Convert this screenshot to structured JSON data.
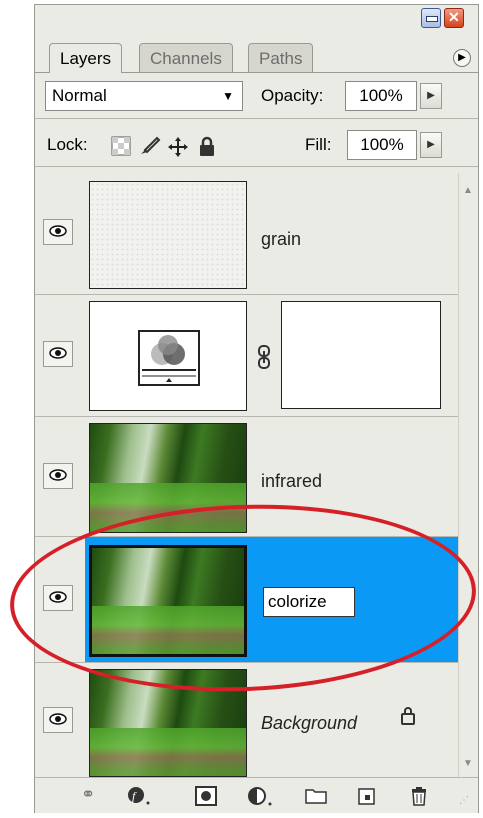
{
  "tabs": [
    {
      "label": "Layers",
      "active": true
    },
    {
      "label": "Channels",
      "active": false
    },
    {
      "label": "Paths",
      "active": false
    }
  ],
  "blend_mode": "Normal",
  "opacity": {
    "label": "Opacity:",
    "value": "100%"
  },
  "lock": {
    "label": "Lock:"
  },
  "fill": {
    "label": "Fill:",
    "value": "100%"
  },
  "layers": [
    {
      "name": "grain",
      "visible": true,
      "thumb": "grain"
    },
    {
      "name": "",
      "visible": true,
      "thumb": "adjustment",
      "has_mask": true
    },
    {
      "name": "infrared",
      "visible": true,
      "thumb": "photo"
    },
    {
      "name": "colorize",
      "visible": true,
      "thumb": "photo",
      "selected": true,
      "editing": true
    },
    {
      "name": "Background",
      "visible": true,
      "thumb": "photo",
      "locked": true
    }
  ],
  "colors": {
    "selection": "#0a9af6",
    "annotation": "#d62027",
    "panel": "#ebebe6"
  },
  "icons": [
    "link-layers-icon",
    "layer-style-icon",
    "add-mask-icon",
    "adjustment-layer-icon",
    "new-group-icon",
    "new-layer-icon",
    "delete-layer-icon"
  ]
}
